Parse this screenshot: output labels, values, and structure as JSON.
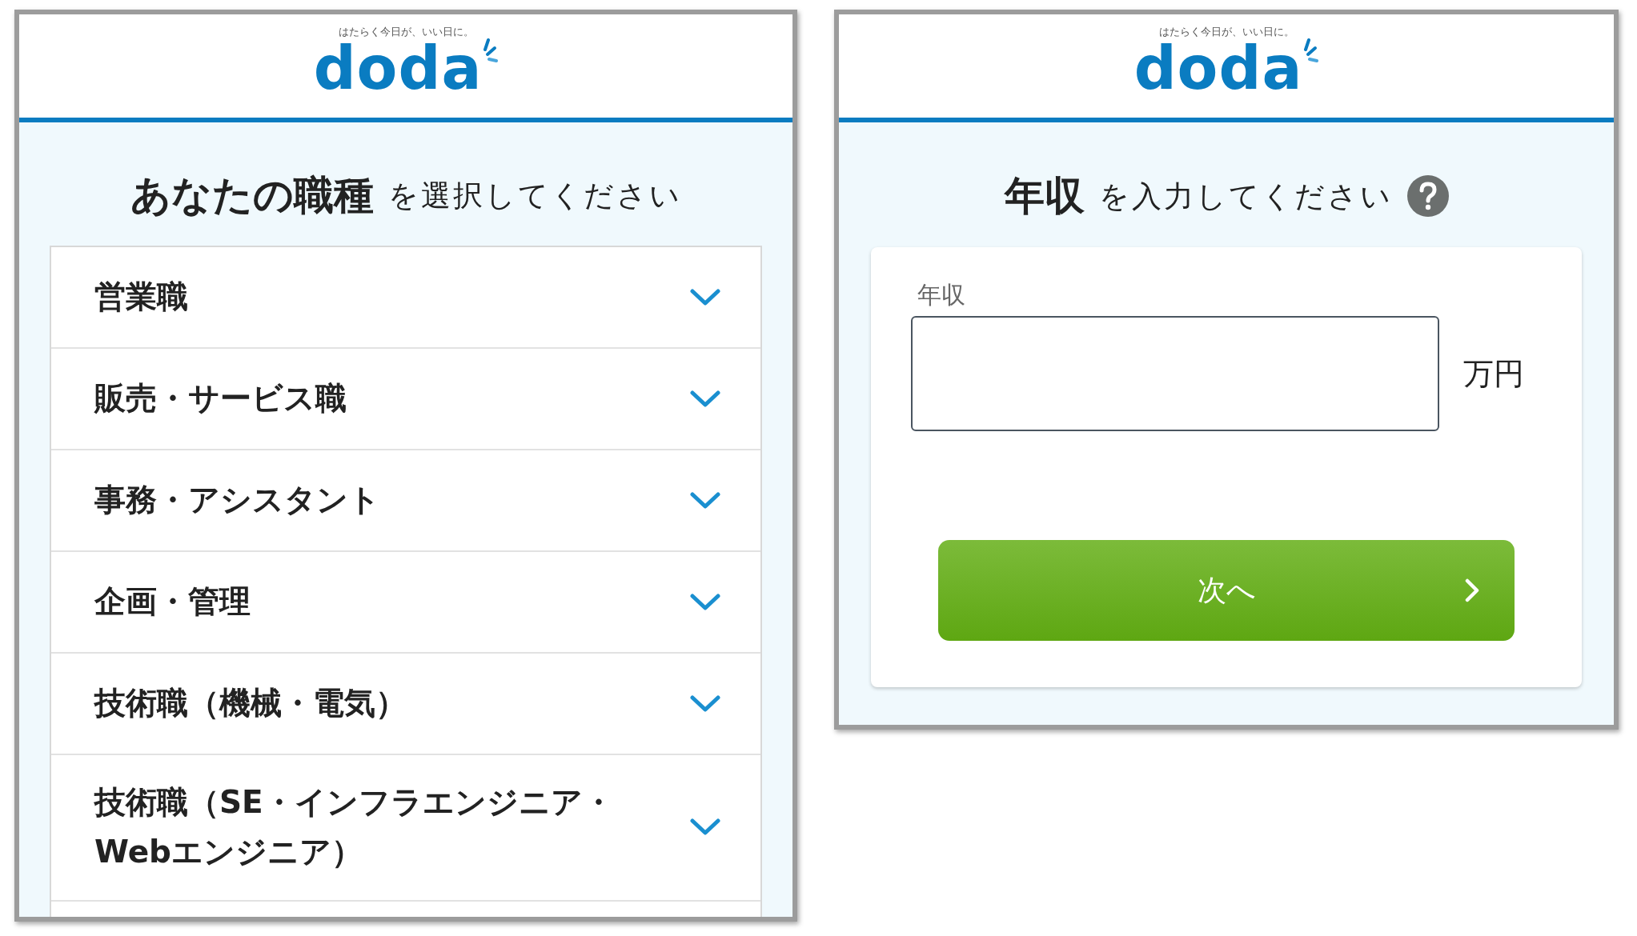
{
  "panels": [
    {
      "kind": "job_select",
      "tagline": "はたらく今日が、いい日に。",
      "logo": "doda",
      "heading_bold": "あなたの職種",
      "heading_rest": "を選択してください",
      "items": [
        {
          "label": "営業職",
          "expanded": false
        },
        {
          "label": "販売・サービス職",
          "expanded": false
        },
        {
          "label": "事務・アシスタント",
          "expanded": false
        },
        {
          "label": "企画・管理",
          "expanded": false
        },
        {
          "label": "技術職（機械・電気）",
          "expanded": false
        },
        {
          "label": "技術職（SE・インフラエンジニア・Webエンジニア）",
          "expanded": false
        }
      ]
    },
    {
      "kind": "salary_input",
      "tagline": "はたらく今日が、いい日に。",
      "logo": "doda",
      "heading_bold": "年収",
      "heading_rest": "を入力してください",
      "field_label": "年収",
      "unit": "万円",
      "button": "次へ"
    }
  ]
}
